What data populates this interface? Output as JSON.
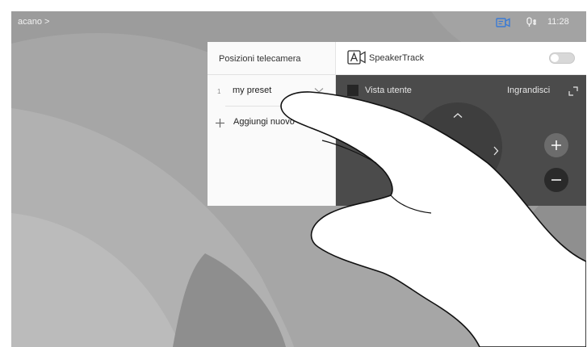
{
  "status_bar": {
    "breadcrumb": "acano >",
    "time": "11:28",
    "icons": [
      "camera-status-icon",
      "microphone-icon"
    ]
  },
  "camera_panel": {
    "presets_title": "Posizioni telecamera",
    "presets": [
      {
        "number": "1",
        "name": "my preset"
      }
    ],
    "add_label": "Aggiungi nuovo",
    "speakertrack_label": "SpeakerTrack",
    "speakertrack_on": false,
    "selfview_label": "Vista utente",
    "zoom_label": "Ingrandisci"
  },
  "colors": {
    "panel_light": "#fafafa",
    "panel_dark": "#4b4b4b",
    "accent": "#3a7bd5",
    "background": "#9a9a9a"
  }
}
